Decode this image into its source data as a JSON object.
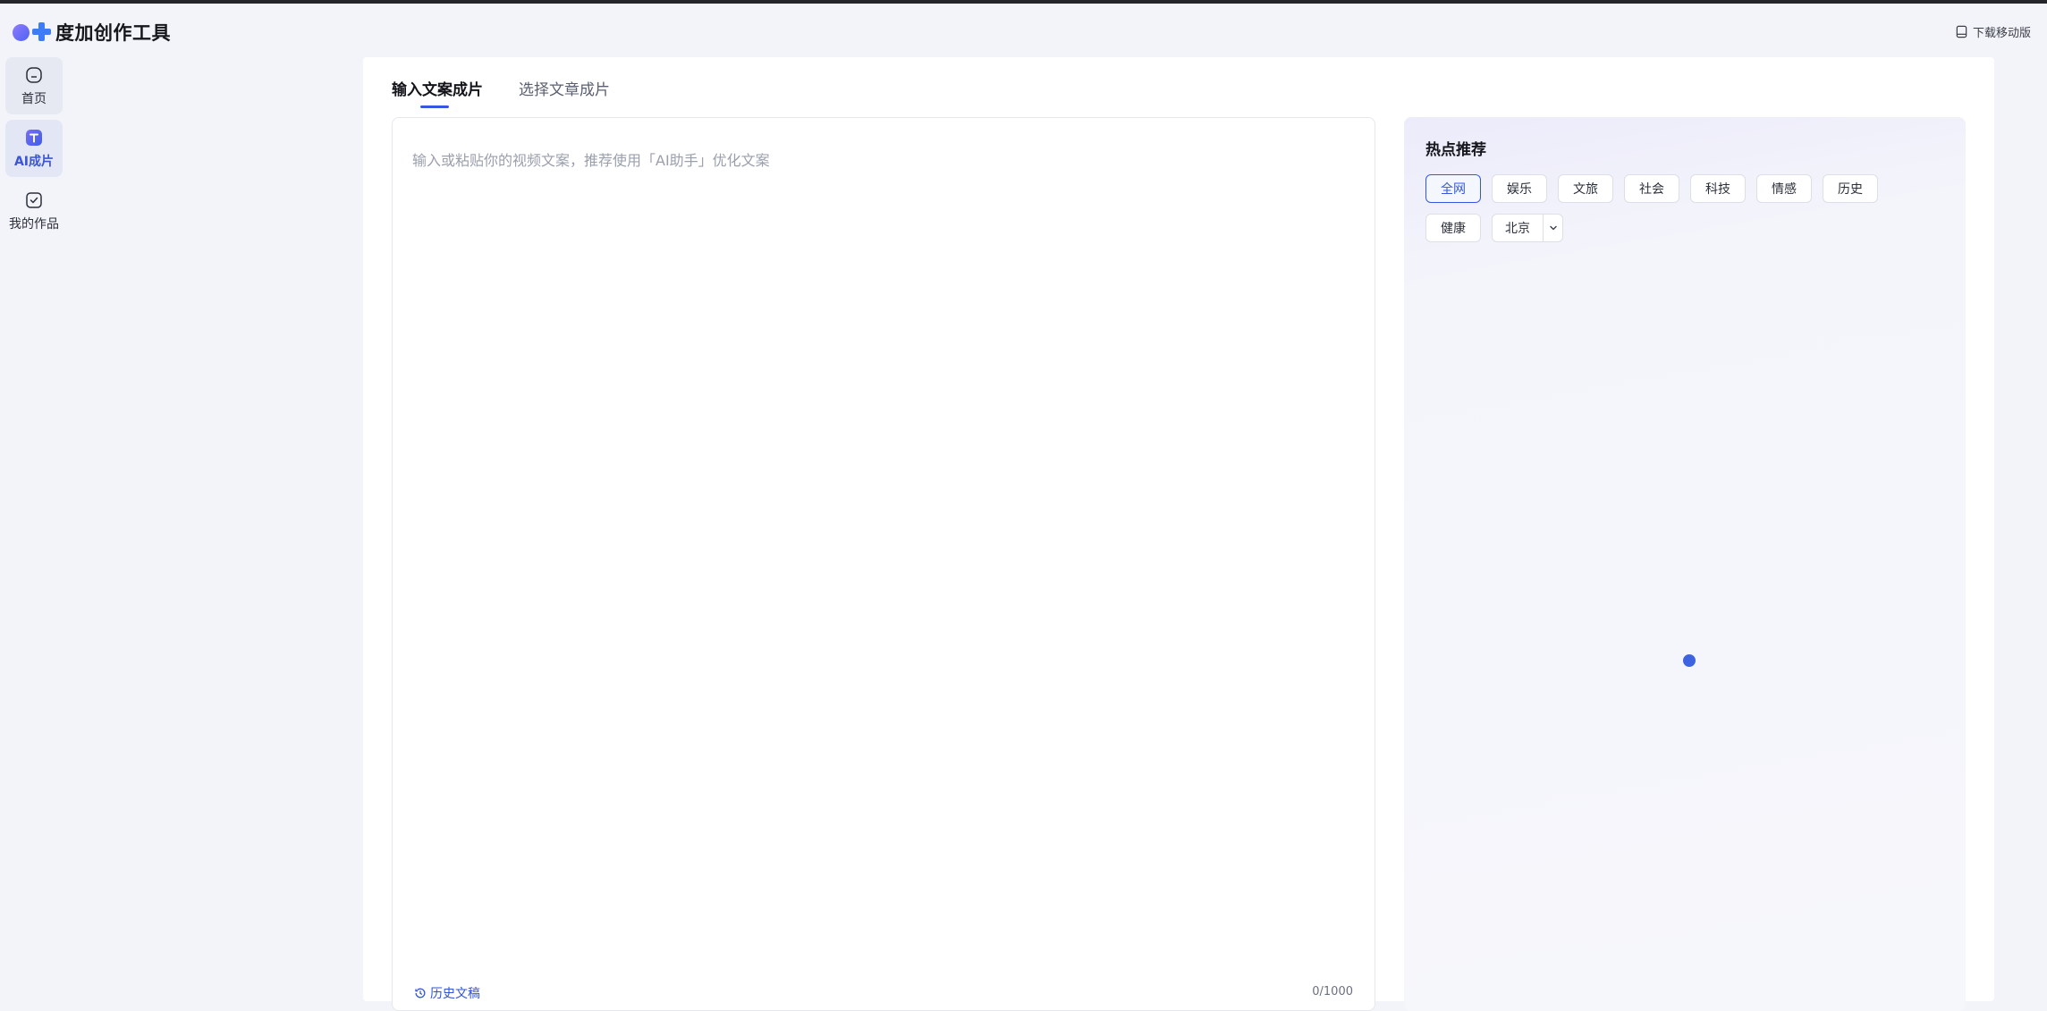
{
  "header": {
    "app_title": "度加创作工具",
    "download_label": "下载移动版"
  },
  "sidebar": {
    "items": [
      {
        "label": "首页",
        "icon": "home-icon"
      },
      {
        "label": "AI成片",
        "icon": "ai-video-icon"
      },
      {
        "label": "我的作品",
        "icon": "works-icon"
      }
    ]
  },
  "tabs": [
    {
      "label": "输入文案成片",
      "active": true
    },
    {
      "label": "选择文章成片",
      "active": false
    }
  ],
  "editor": {
    "placeholder": "输入或粘贴你的视频文案，推荐使用「AI助手」优化文案",
    "value": "",
    "history_label": "历史文稿",
    "counter": "0/1000"
  },
  "hot": {
    "title": "热点推荐",
    "categories": [
      "全网",
      "娱乐",
      "文旅",
      "社会",
      "科技",
      "情感",
      "历史",
      "健康"
    ],
    "active_category": "全网",
    "city": "北京"
  },
  "colors": {
    "accent": "#3557e0",
    "active_nav_text": "#3a55d6",
    "loading_dot": "#3d63e0"
  }
}
